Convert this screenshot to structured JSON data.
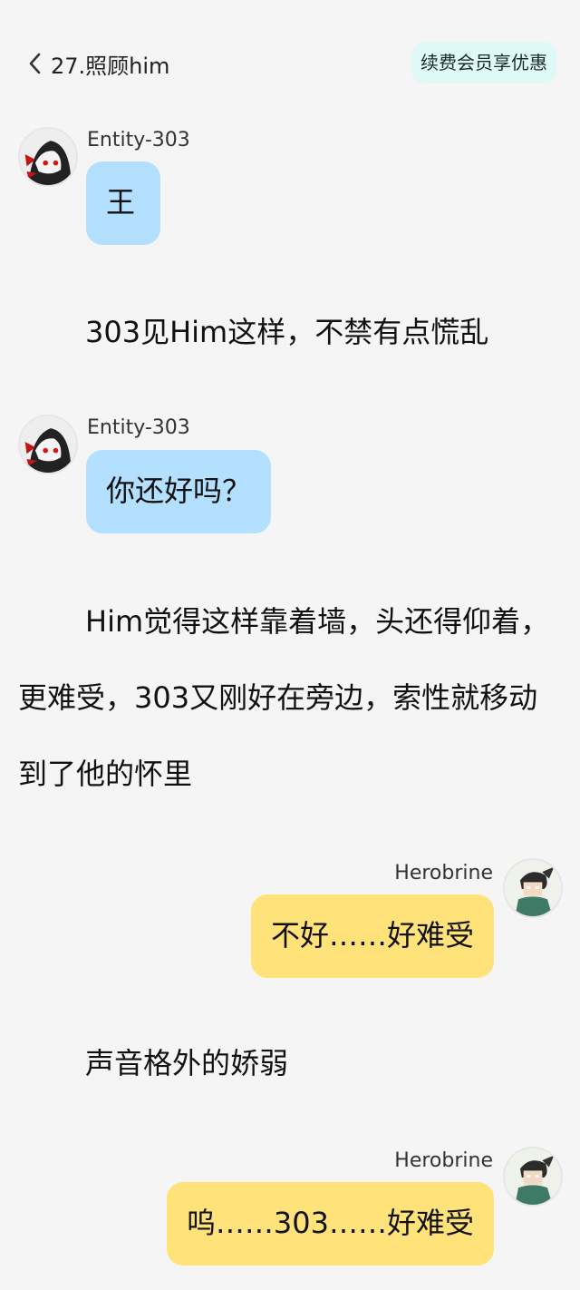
{
  "header": {
    "back_title": "27.照顾him",
    "vip_button": "续费会员享优惠"
  },
  "messages": [
    {
      "sender": "Entity-303",
      "text": "王"
    },
    {
      "narration": "303见Him这样，不禁有点慌乱"
    },
    {
      "sender": "Entity-303",
      "text": "你还好吗？"
    },
    {
      "narration": "Him觉得这样靠着墙，头还得仰着，更难受，303又刚好在旁边，索性就移动到了他的怀里"
    },
    {
      "sender": "Herobrine",
      "text": "不好……好难受"
    },
    {
      "narration": "声音格外的娇弱"
    },
    {
      "sender": "Herobrine",
      "text": "呜……303……好难受"
    }
  ],
  "colors": {
    "left_bubble": "#b3e0ff",
    "right_bubble": "#ffe27a",
    "vip_bg": "#dff9f6",
    "background": "#f5f5f5"
  },
  "icons": {
    "back": "chevron-left-icon",
    "entity_avatar": "entity-303-avatar",
    "herobrine_avatar": "herobrine-avatar"
  }
}
